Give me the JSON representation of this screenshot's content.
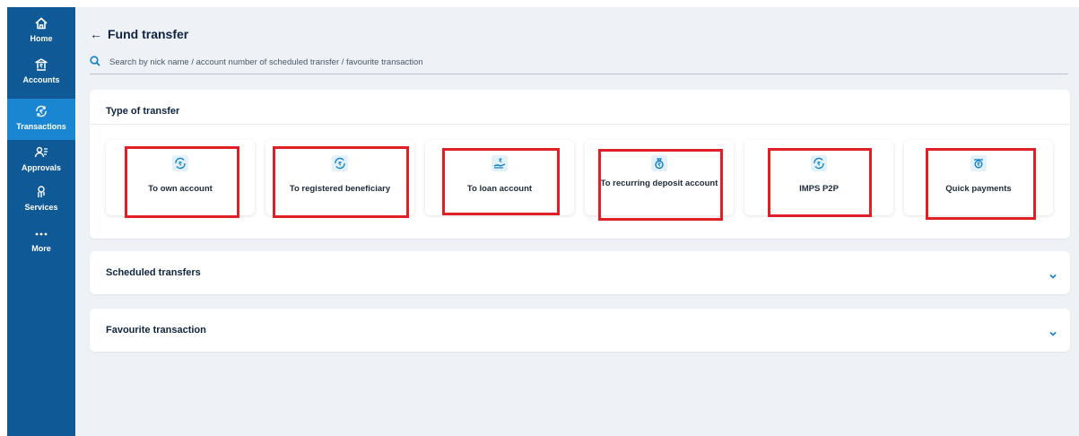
{
  "sidebar": {
    "items": [
      {
        "label": "Home",
        "icon": "home-icon"
      },
      {
        "label": "Accounts",
        "icon": "bank-icon"
      },
      {
        "label": "Transactions",
        "icon": "rupee-transfer-icon",
        "active": true
      },
      {
        "label": "Approvals",
        "icon": "people-approve-icon"
      },
      {
        "label": "Services",
        "icon": "hand-service-icon"
      },
      {
        "label": "More",
        "icon": "more-dots-icon"
      }
    ]
  },
  "header": {
    "back_icon": "←",
    "title": "Fund transfer"
  },
  "search": {
    "placeholder": "Search by nick name / account number of scheduled transfer / favourite transaction"
  },
  "type_of_transfer": {
    "heading": "Type of transfer",
    "tiles": [
      {
        "label": "To own account",
        "icon": "rupee-transfer-icon"
      },
      {
        "label": "To registered beneficiary",
        "icon": "rupee-transfer-icon"
      },
      {
        "label": "To loan account",
        "icon": "hand-rupee-icon"
      },
      {
        "label": "To recurring deposit account",
        "icon": "money-bag-icon"
      },
      {
        "label": "IMPS P2P",
        "icon": "rupee-transfer-icon"
      },
      {
        "label": "Quick payments",
        "icon": "rupee-wallet-icon"
      }
    ]
  },
  "scheduled_transfers": {
    "heading": "Scheduled transfers"
  },
  "favourite_transaction": {
    "heading": "Favourite transaction"
  },
  "colors": {
    "sidebar": "#0f5a96",
    "sidebar_active": "#1a86d1",
    "page_bg": "#eef2f7",
    "highlight": "#e01f26",
    "accent": "#0e7fc8"
  }
}
